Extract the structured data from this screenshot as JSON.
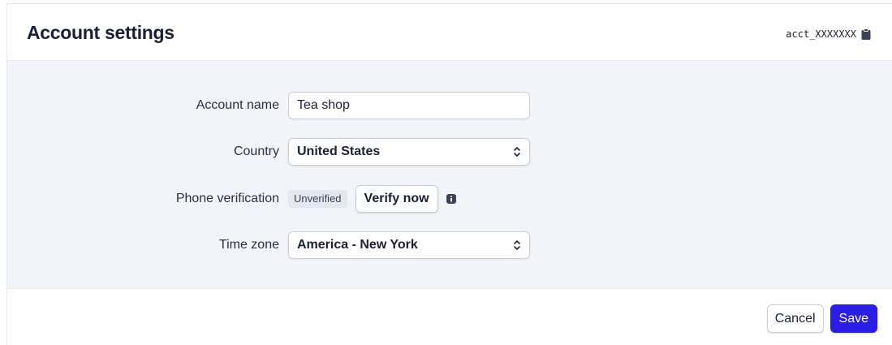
{
  "header": {
    "title": "Account settings",
    "account_id": "acct_XXXXXXX",
    "copy_icon": "clipboard-icon"
  },
  "form": {
    "account_name": {
      "label": "Account name",
      "value": "Tea shop"
    },
    "country": {
      "label": "Country",
      "value": "United States",
      "icon": "chevron-up-down-icon"
    },
    "phone": {
      "label": "Phone verification",
      "status": "Unverified",
      "verify_label": "Verify now",
      "icon": "info-icon"
    },
    "timezone": {
      "label": "Time zone",
      "value": "America - New York",
      "icon": "chevron-up-down-icon"
    }
  },
  "footer": {
    "cancel_label": "Cancel",
    "save_label": "Save"
  },
  "colors": {
    "accent": "#2a1de8",
    "body_background": "#f1f5f9",
    "badge_background": "#e3e8ee"
  }
}
